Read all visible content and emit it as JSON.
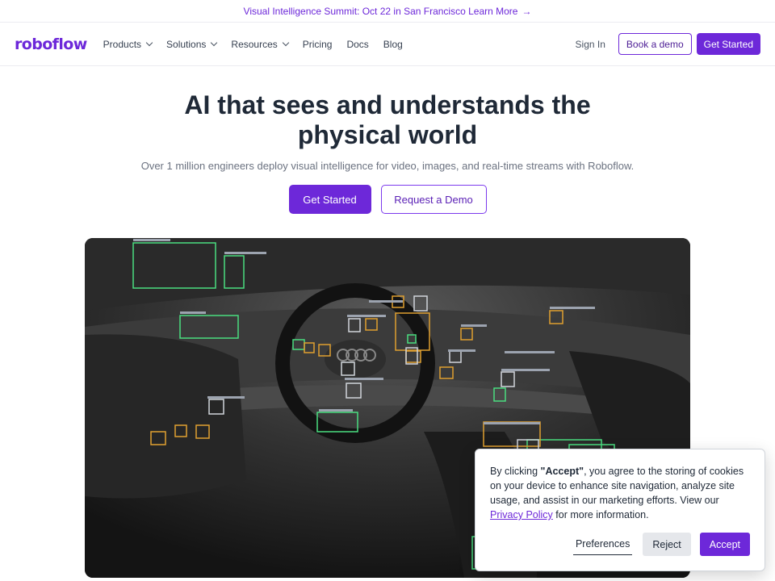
{
  "banner": {
    "text": "Visual Intelligence Summit: Oct 22 in San Francisco Learn More",
    "arrow": "→"
  },
  "nav": {
    "logo": "roboflow",
    "items": [
      {
        "label": "Products",
        "dropdown": true
      },
      {
        "label": "Solutions",
        "dropdown": true
      },
      {
        "label": "Resources",
        "dropdown": true
      },
      {
        "label": "Pricing",
        "dropdown": false
      },
      {
        "label": "Docs",
        "dropdown": false
      },
      {
        "label": "Blog",
        "dropdown": false
      }
    ],
    "sign_in": "Sign In",
    "book_demo": "Book a demo",
    "get_started": "Get Started"
  },
  "hero": {
    "title": "AI that sees and understands the physical world",
    "subtitle": "Over 1 million engineers deploy visual intelligence for video, images, and real-time streams with Roboflow.",
    "primary_cta": "Get Started",
    "secondary_cta": "Request a Demo"
  },
  "media": {
    "description_icon": "car-interior-detection-image",
    "detection_colors": {
      "green": "#4ade80",
      "orange": "#e0a030",
      "white": "#d1d5db"
    }
  },
  "cookie": {
    "text_before": "By clicking ",
    "accept_quote": "\"Accept\"",
    "text_middle": ", you agree to the storing of cookies on your device to enhance site navigation, analyze site usage, and assist in our marketing efforts. View our ",
    "privacy_link": "Privacy Policy",
    "text_after": " for more information.",
    "preferences": "Preferences",
    "reject": "Reject",
    "accept": "Accept"
  },
  "colors": {
    "brand": "#6d28d9",
    "text": "#1f2937",
    "muted": "#6b7280"
  }
}
